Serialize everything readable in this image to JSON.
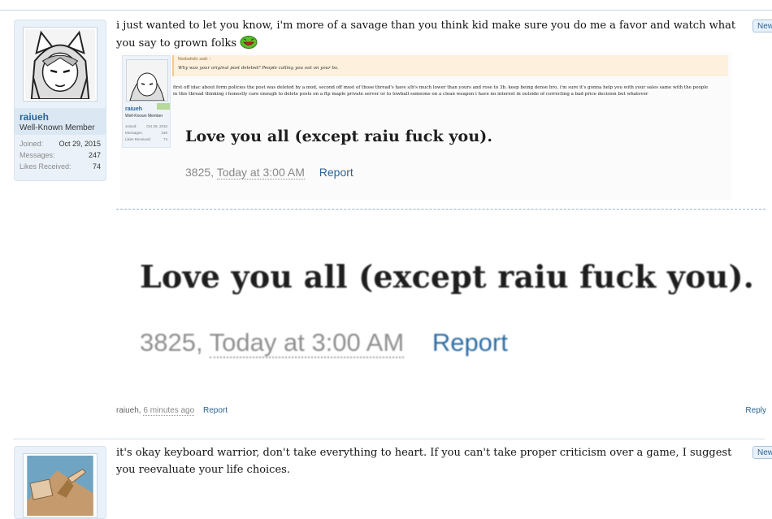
{
  "post1": {
    "username": "raiueh",
    "user_title": "Well-Known Member",
    "stats": [
      {
        "label": "Joined:",
        "value": "Oct 29, 2015"
      },
      {
        "label": "Messages:",
        "value": "247"
      },
      {
        "label": "Likes Received:",
        "value": "74"
      }
    ],
    "message": "i just wanted to let you know, i'm more of a savage than you think kid make sure you do me a favor and watch what you say to grown folks",
    "new_badge": "New",
    "embedded": {
      "quote_author": "Noobaholic said: ↑",
      "quote_text": "Why was your original post deleted? People calling you out on your bs.",
      "body_text": "first off idac about form policies the post was deleted by a mod, second off most of those thread's have s/b's much lower than yours and rose to 3b. keep being dense bro, i'm sure it's gonna help you with your sales same with the people in this thread thinking i honestly care enough to delete posts on a ftp maple private server or to lowball someone on a clean weapon i have no interest in outside of correcting a bad price decision but whatever",
      "mini_username": "raiueh",
      "mini_title": "Well-Known Member",
      "mini_stats": [
        {
          "label": "Joined:",
          "value": "Oct 29, 2015"
        },
        {
          "label": "Messages:",
          "value": "246"
        },
        {
          "label": "Likes Received:",
          "value": "74"
        }
      ]
    },
    "big_text": "Love you all (except raiu fuck you).",
    "big_meta_id": "3825,",
    "big_meta_time": "Today at 3:00 AM",
    "big_meta_report": "Report",
    "footer_author": "raiueh,",
    "footer_time": "6 minutes ago",
    "footer_report": "Report",
    "footer_reply": "Reply"
  },
  "post2": {
    "message": "it's okay keyboard warrior, don't take everything to heart. If you can't take proper criticism over a game, I suggest you reevaluate your life choices.",
    "new_badge": "New"
  },
  "colors": {
    "link": "#2a6496",
    "card_bg": "#eaf1f8",
    "dashed_border": "#9ab6cc"
  },
  "icons": [
    "avatar-anime-girl",
    "green-laughing-smiley",
    "avatar-pointing-hand"
  ]
}
